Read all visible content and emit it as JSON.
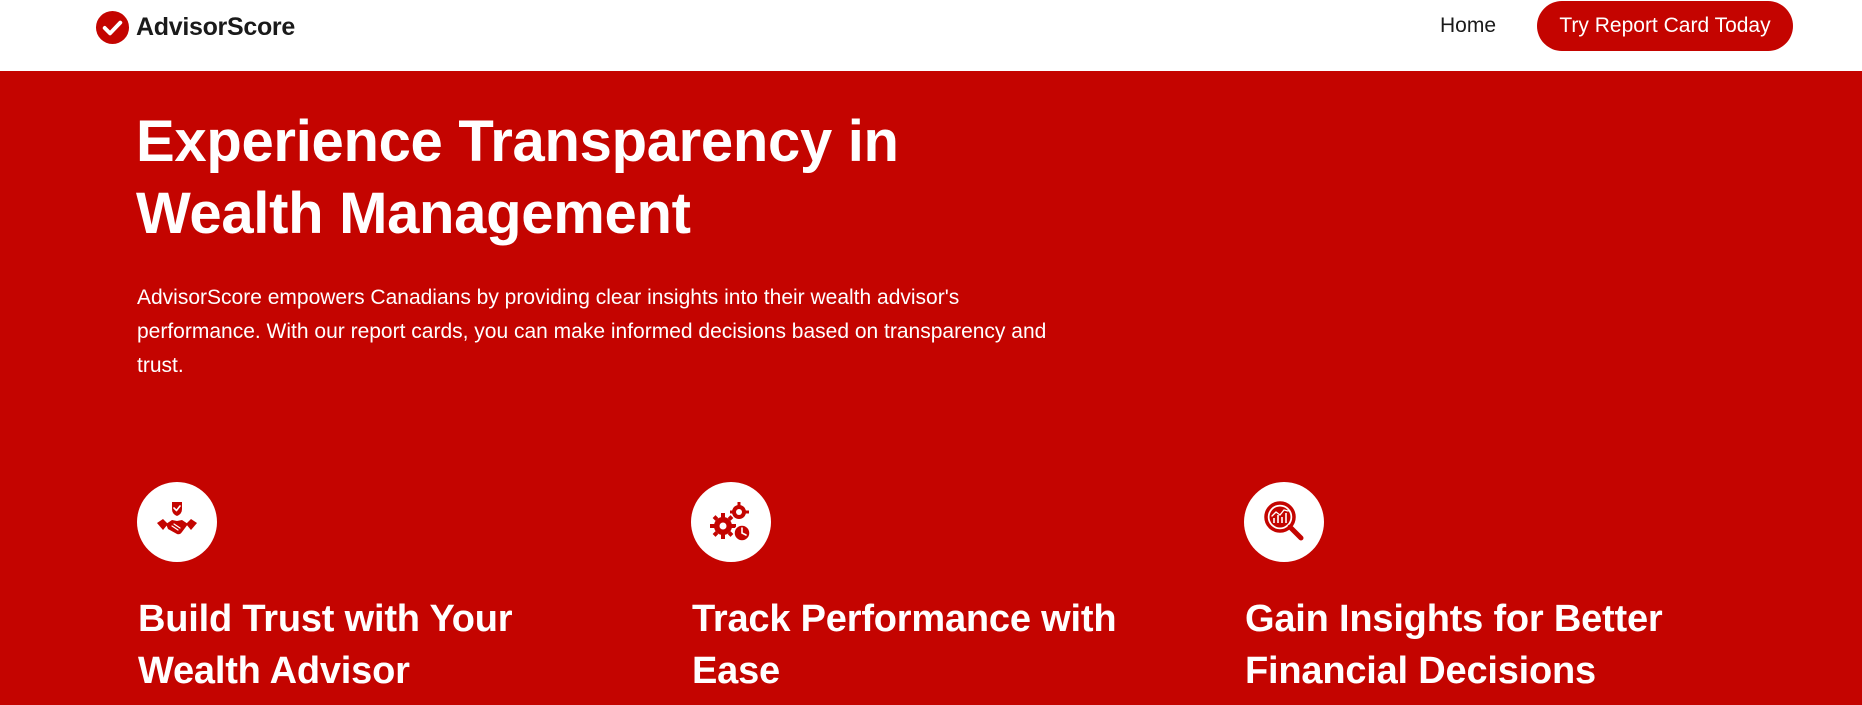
{
  "colors": {
    "brand_red": "#c40400",
    "header_bg": "#ffffff",
    "text_dark": "#1a1a1a",
    "text_light": "#ffffff"
  },
  "header": {
    "logo_text": "AdvisorScore",
    "logo_icon": "check-circle-icon",
    "nav_home": "Home",
    "cta_label": "Try Report Card Today"
  },
  "hero": {
    "title": "Experience Transparency in Wealth Management",
    "description": "AdvisorScore empowers Canadians by providing clear insights into their wealth advisor's performance. With our report cards, you can make informed decisions based on transparency and trust."
  },
  "features": [
    {
      "icon": "handshake-shield-icon",
      "title": "Build Trust with Your Wealth Advisor"
    },
    {
      "icon": "gears-clock-icon",
      "title": "Track Performance with Ease"
    },
    {
      "icon": "magnifier-chart-icon",
      "title": "Gain Insights for Better Financial Decisions"
    }
  ]
}
